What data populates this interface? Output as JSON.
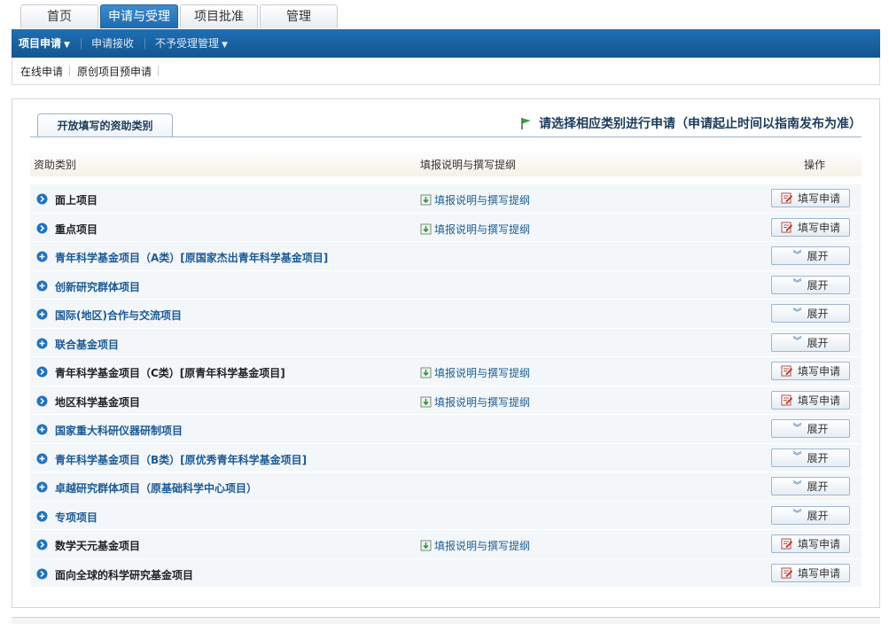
{
  "top_tabs": [
    {
      "label": "首页",
      "active": false
    },
    {
      "label": "申请与受理",
      "active": true
    },
    {
      "label": "项目批准",
      "active": false
    },
    {
      "label": "管理",
      "active": false
    }
  ],
  "menu": [
    {
      "label": "项目申请",
      "active": true,
      "dropdown": true
    },
    {
      "label": "申请接收",
      "active": false,
      "dropdown": false
    },
    {
      "label": "不予受理管理",
      "active": false,
      "dropdown": true
    }
  ],
  "submenu": [
    {
      "label": "在线申请"
    },
    {
      "label": "原创项目预申请"
    }
  ],
  "panel": {
    "tab_label": "开放填写的资助类别",
    "notice": "请选择相应类别进行申请（申请起止时间以指南发布为准）",
    "headers": {
      "category": "资助类别",
      "guide": "填报说明与撰写提纲",
      "action": "操作"
    }
  },
  "buttons": {
    "apply": "填写申请",
    "expand": "展开"
  },
  "rows": [
    {
      "name": "面上项目",
      "guide": "填报说明与撰写提纲",
      "type": "apply"
    },
    {
      "name": "重点项目",
      "guide": "填报说明与撰写提纲",
      "type": "apply"
    },
    {
      "name": "青年科学基金项目（A类）[原国家杰出青年科学基金项目]",
      "guide": "",
      "type": "expand"
    },
    {
      "name": "创新研究群体项目",
      "guide": "",
      "type": "expand"
    },
    {
      "name": "国际(地区)合作与交流项目",
      "guide": "",
      "type": "expand"
    },
    {
      "name": "联合基金项目",
      "guide": "",
      "type": "expand"
    },
    {
      "name": "青年科学基金项目（C类）[原青年科学基金项目]",
      "guide": "填报说明与撰写提纲",
      "type": "apply"
    },
    {
      "name": "地区科学基金项目",
      "guide": "填报说明与撰写提纲",
      "type": "apply"
    },
    {
      "name": "国家重大科研仪器研制项目",
      "guide": "",
      "type": "expand"
    },
    {
      "name": "青年科学基金项目（B类）[原优秀青年科学基金项目]",
      "guide": "",
      "type": "expand"
    },
    {
      "name": "卓越研究群体项目（原基础科学中心项目）",
      "guide": "",
      "type": "expand"
    },
    {
      "name": "专项项目",
      "guide": "",
      "type": "expand"
    },
    {
      "name": "数学天元基金项目",
      "guide": "填报说明与撰写提纲",
      "type": "apply"
    },
    {
      "name": "面向全球的科学研究基金项目",
      "guide": "",
      "type": "apply"
    }
  ],
  "colors": {
    "brand_blue": "#1e6fb4",
    "link_blue": "#1b5d95"
  }
}
